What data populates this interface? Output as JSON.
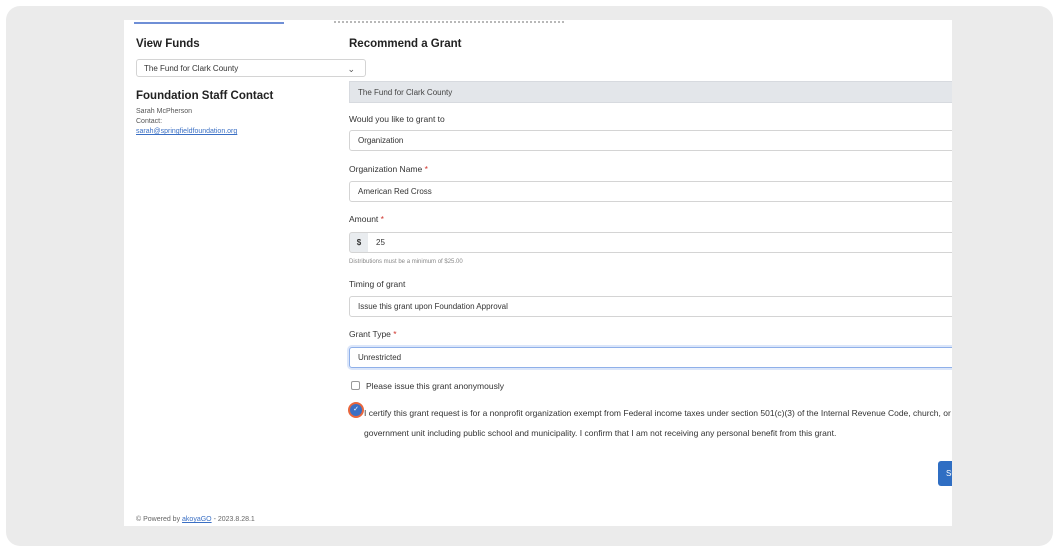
{
  "left": {
    "view_funds_title": "View Funds",
    "fund_select_value": "The Fund for Clark County",
    "staff_title": "Foundation Staff Contact",
    "staff_name": "Sarah McPherson",
    "staff_contact_label": "Contact:",
    "staff_email": "sarah@springfieldfoundation.org"
  },
  "form": {
    "title": "Recommend a Grant",
    "fund_banner": "The Fund for Clark County",
    "grant_to_label": "Would you like to grant to",
    "grant_to_value": "Organization",
    "org_name_label": "Organization Name",
    "org_name_value": "American Red Cross",
    "amount_label": "Amount",
    "currency_symbol": "$",
    "amount_value": "25",
    "amount_hint": "Distributions must be a minimum of $25.00",
    "timing_label": "Timing of grant",
    "timing_value": "Issue this grant upon Foundation Approval",
    "grant_type_label": "Grant Type",
    "grant_type_value": "Unrestricted",
    "required_marker": "*",
    "anonymous_label": "Please issue this grant anonymously",
    "anonymous_checked": false,
    "certify_text": "I certify this grant request is for a nonprofit organization exempt from Federal income taxes under section 501(c)(3) of the Internal Revenue Code, church, or government unit including public school and municipality. I confirm that I am not receiving any personal benefit from this grant.",
    "certify_checked": true,
    "submit_label": "Submit"
  },
  "footer": {
    "powered_prefix": "© Powered by",
    "powered_link": "akoyaGO",
    "powered_suffix": "- 2023.8.28.1"
  },
  "colors": {
    "accent": "#2f6ec3",
    "required": "#d0342c",
    "highlight_ring": "#e8663d"
  }
}
